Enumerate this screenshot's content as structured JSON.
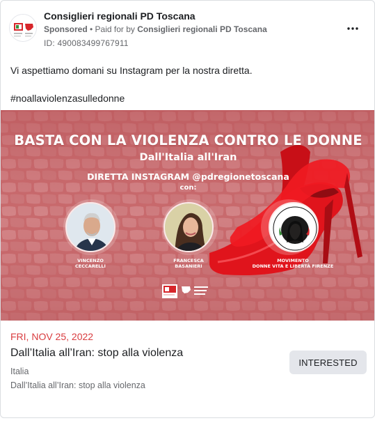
{
  "page": {
    "name": "Consiglieri regionali PD Toscana",
    "sponsored_label": "Sponsored",
    "paid_for_prefix": " • Paid for by ",
    "paid_for_by": "Consiglieri regionali PD Toscana",
    "ad_id": "ID: 490083499767911",
    "more_icon": "more-horizontal-icon"
  },
  "post": {
    "body_text": "Vi aspettiamo domani su Instagram per la nostra diretta.",
    "hashtag": "#noallaviolenzasulledonne"
  },
  "creative": {
    "title": "BASTA CON  LA VIOLENZA CONTRO LE DONNE",
    "subtitle": "Dall'Italia all'Iran",
    "live_line": "DIRETTA INSTAGRAM @pdregionetoscana",
    "with_label": "con:",
    "guests": [
      {
        "line1": "VINCENZO",
        "line2": "CECCARELLI"
      },
      {
        "line1": "FRANCESCA",
        "line2": "BASANIERI"
      },
      {
        "line1": "MOVIMENTO",
        "line2": "DONNE VITA E LIBERTÀ FIRENZE"
      }
    ],
    "movement_logo_text": "DONNA VITA LIBERTÀ",
    "background_color": "#c9676b",
    "shoe_color": "#e0141c"
  },
  "event": {
    "date": "FRI, NOV 25, 2022",
    "title": "Dall’Italia all’Iran: stop alla violenza",
    "location": "Italia",
    "description": "Dall’Italia all’Iran: stop alla violenza",
    "cta_label": "INTERESTED"
  },
  "colors": {
    "date_red": "#d93c3f",
    "secondary_text": "#65676b",
    "button_bg": "#e4e6eb"
  }
}
